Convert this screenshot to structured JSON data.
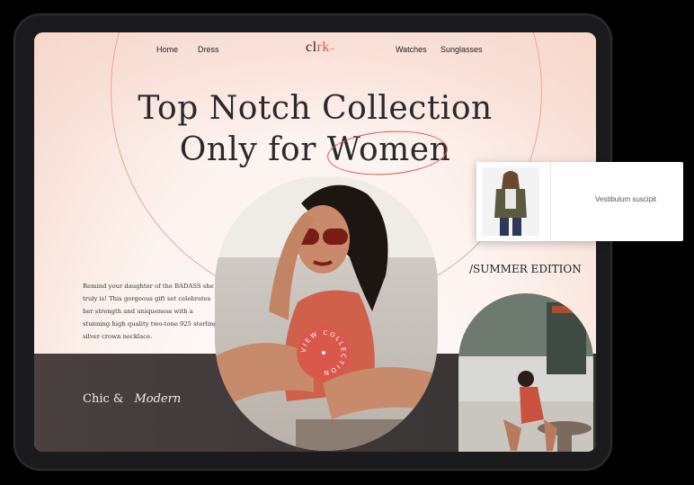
{
  "nav": {
    "left": [
      "Home",
      "Dress"
    ],
    "right": [
      "Watches",
      "Sunglasses"
    ],
    "logo": {
      "text": "clrk",
      "accent_letter": "k",
      "suffix": "–"
    }
  },
  "hero": {
    "line1": "Top Notch Collection",
    "line2_prefix": "Only for ",
    "line2_highlight": "Women"
  },
  "description": "Remind your daughter of the BADASS she truly is! This gorgeous gift set celebrates her strength and uniqueness with a stunning high quality two-tone 925 sterling silver crown necklace.",
  "band": {
    "word1": "Chic &",
    "word2": "Modern"
  },
  "badge": {
    "text": "VIEW COLLECTION"
  },
  "summer": {
    "label": "/SUMMER EDITION"
  },
  "popup": {
    "caption": "Vestibulum suscipit"
  },
  "colors": {
    "accent": "#d9584b",
    "dark_band": "#3d3838",
    "ring": "#e9a79a"
  }
}
